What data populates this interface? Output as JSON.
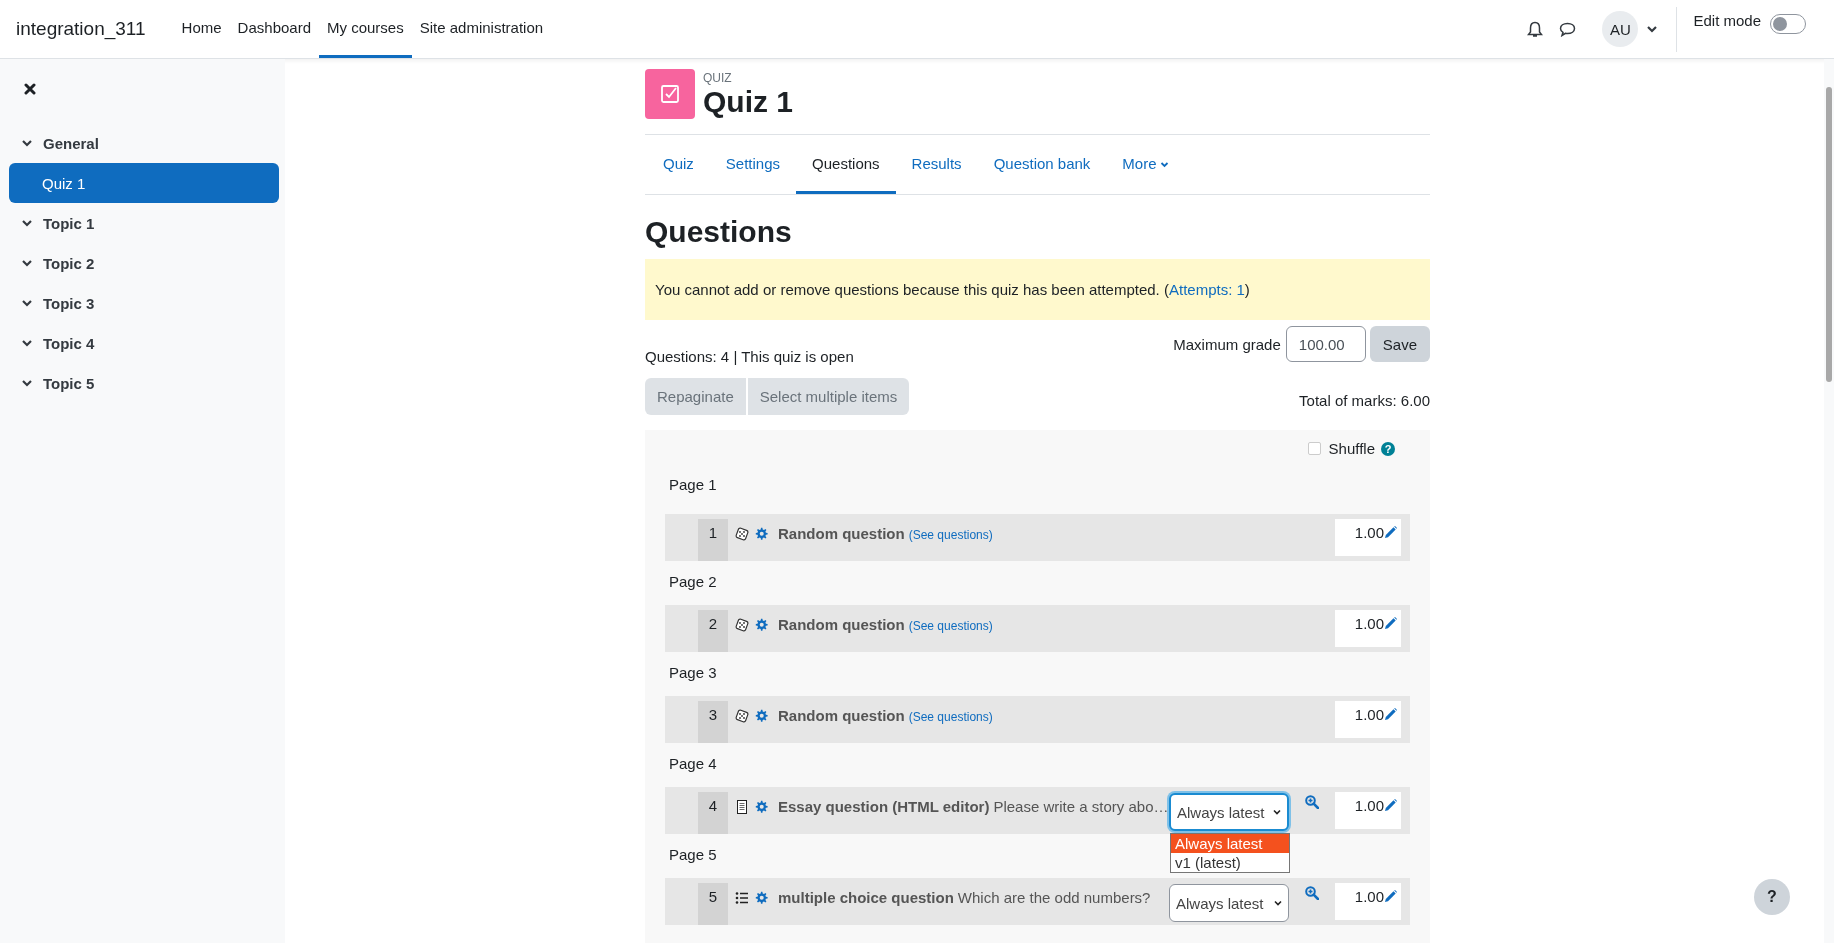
{
  "navbar": {
    "site_name": "integration_311",
    "links": [
      {
        "label": "Home",
        "selected": false
      },
      {
        "label": "Dashboard",
        "selected": false
      },
      {
        "label": "My courses",
        "selected": true
      },
      {
        "label": "Site administration",
        "selected": false
      }
    ],
    "user_initials": "AU",
    "edit_mode": {
      "label": "Edit mode",
      "on": false
    }
  },
  "sidebar": {
    "sections": [
      {
        "title": "General",
        "expanded": true,
        "children": [
          {
            "label": "Quiz 1",
            "selected": true
          }
        ]
      },
      {
        "title": "Topic 1",
        "expanded": true
      },
      {
        "title": "Topic 2",
        "expanded": true
      },
      {
        "title": "Topic 3",
        "expanded": true
      },
      {
        "title": "Topic 4",
        "expanded": true
      },
      {
        "title": "Topic 5",
        "expanded": true
      }
    ]
  },
  "header": {
    "module_type": "QUIZ",
    "title": "Quiz 1"
  },
  "tabs": [
    {
      "label": "Quiz",
      "selected": false
    },
    {
      "label": "Settings",
      "selected": false
    },
    {
      "label": "Questions",
      "selected": true
    },
    {
      "label": "Results",
      "selected": false
    },
    {
      "label": "Question bank",
      "selected": false
    },
    {
      "label": "More",
      "selected": false,
      "kind": "dropdown"
    }
  ],
  "heading": "Questions",
  "alert": {
    "text": "You cannot add or remove questions because this quiz has been attempted. (",
    "link": "Attempts: 1",
    "after": ")"
  },
  "summary": "Questions: 4 | This quiz is open",
  "max_grade": {
    "label": "Maximum grade",
    "value": "100.00",
    "button": "Save"
  },
  "actions": [
    {
      "label": "Repaginate",
      "disabled": true
    },
    {
      "label": "Select multiple items",
      "disabled": true
    }
  ],
  "total_marks": "Total of marks: 6.00",
  "shuffle": {
    "label": "Shuffle",
    "checked": false,
    "help": "?"
  },
  "pages": [
    {
      "label": "Page 1",
      "questions": [
        {
          "number": "1",
          "kind": "random",
          "name": "Random question",
          "link": "(See questions)",
          "mark": "1.00"
        }
      ]
    },
    {
      "label": "Page 2",
      "questions": [
        {
          "number": "2",
          "kind": "random",
          "name": "Random question",
          "link": "(See questions)",
          "mark": "1.00"
        }
      ]
    },
    {
      "label": "Page 3",
      "questions": [
        {
          "number": "3",
          "kind": "random",
          "name": "Random question",
          "link": "(See questions)",
          "mark": "1.00"
        }
      ]
    },
    {
      "label": "Page 4",
      "questions": [
        {
          "number": "4",
          "kind": "essay",
          "name": "Essay question (HTML editor)",
          "text": "Please write a story abo…",
          "version": {
            "value": "Always latest",
            "open": true,
            "options": [
              {
                "label": "Always latest",
                "selected": true
              },
              {
                "label": "v1 (latest)",
                "selected": false
              }
            ]
          },
          "mark": "1.00"
        }
      ]
    },
    {
      "label": "Page 5",
      "questions": [
        {
          "number": "5",
          "kind": "multichoice",
          "name": "multiple choice question",
          "text": "Which are the odd numbers?",
          "version": {
            "value": "Always latest",
            "open": false
          },
          "mark": "1.00"
        }
      ]
    }
  ],
  "help_button": "?"
}
